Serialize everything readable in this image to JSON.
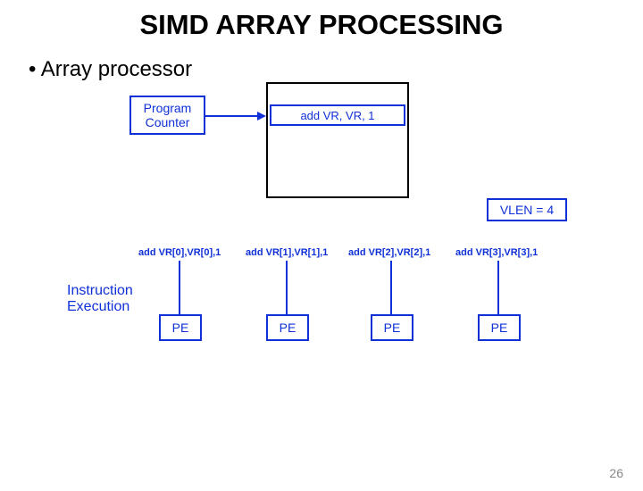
{
  "title": "SIMD ARRAY PROCESSING",
  "bullet": "Array processor",
  "program_counter": "Program\nCounter",
  "instruction": "add  VR, VR, 1",
  "vlen": "VLEN = 4",
  "instr_exec": "Instruction\nExecution",
  "pe": {
    "labels": [
      "add VR[0],VR[0],1",
      "add VR[1],VR[1],1",
      "add VR[2],VR[2],1",
      "add VR[3],VR[3],1"
    ],
    "name": "PE"
  },
  "page": "26"
}
